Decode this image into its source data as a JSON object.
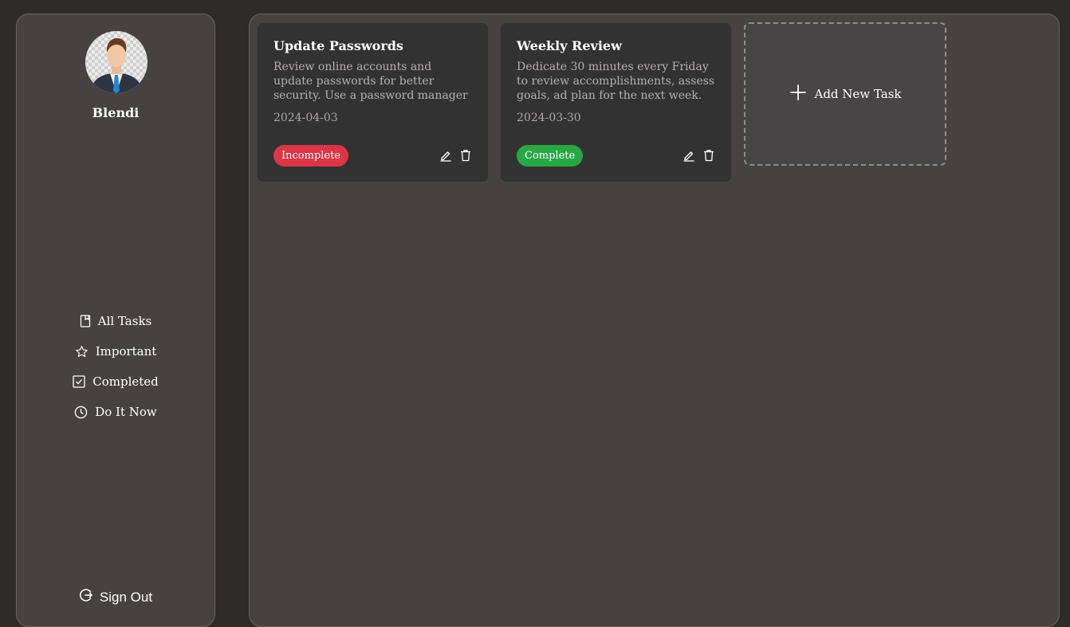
{
  "user": {
    "name": "Blendi"
  },
  "nav": {
    "items": [
      {
        "label": "All Tasks",
        "icon": "bookmark-icon"
      },
      {
        "label": "Important",
        "icon": "star-icon"
      },
      {
        "label": "Completed",
        "icon": "checkbox-icon"
      },
      {
        "label": "Do It Now",
        "icon": "clock-icon"
      }
    ],
    "sign_out": "Sign Out"
  },
  "tasks": [
    {
      "title": "Update Passwords",
      "description": "Review online accounts and update passwords for better security. Use a password manager to keep track",
      "date": "2024-04-03",
      "status": "Incomplete",
      "status_color": "#dc3545"
    },
    {
      "title": "Weekly Review",
      "description": "Dedicate 30 minutes every Friday to review accomplishments, assess goals, ad plan for the next week.",
      "date": "2024-03-30",
      "status": "Complete",
      "status_color": "#28a745"
    }
  ],
  "add_task": {
    "label": "Add New Task"
  },
  "colors": {
    "background": "#2e2b2a",
    "panel": "#474141",
    "card": "#333232"
  }
}
